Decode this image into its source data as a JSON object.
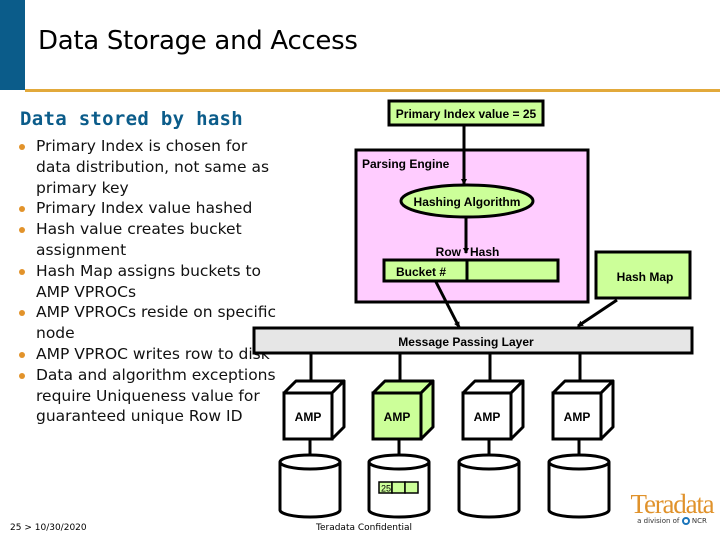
{
  "slide": {
    "title": "Data Storage and Access",
    "subtitle": "Data stored by hash",
    "bullets": [
      "Primary Index is chosen for data distribution, not same as primary key",
      "Primary Index value hashed",
      "Hash value creates bucket assignment",
      "Hash Map assigns buckets to AMP VPROCs",
      "AMP VPROCs reside on specific node",
      "AMP VPROC writes row to disk",
      "Data and algorithm exceptions require Uniqueness value for guaranteed unique Row ID"
    ],
    "colors": {
      "accent_blue": "#0b5c8a",
      "accent_orange": "#e2a93b",
      "box_green": "#ccff99",
      "parsing_engine_pink": "#ffccff",
      "mpl_gray": "#e6e6e6"
    }
  },
  "diagram": {
    "primary_index_label": "Primary Index value = 25",
    "parsing_engine_label": "Parsing Engine",
    "hashing_algorithm_label": "Hashing Algorithm",
    "row_label": "Row",
    "hash_label": "Hash",
    "bucket_label": "Bucket #",
    "hash_map_label": "Hash Map",
    "message_passing_layer_label": "Message Passing Layer",
    "amps": [
      {
        "label": "AMP",
        "highlighted": false
      },
      {
        "label": "AMP",
        "highlighted": true
      },
      {
        "label": "AMP",
        "highlighted": false
      },
      {
        "label": "AMP",
        "highlighted": false
      }
    ],
    "stored_row_value": "25"
  },
  "footer": {
    "page_number": "25",
    "separator": ">",
    "date": "10/30/2020",
    "confidential": "Teradata Confidential",
    "logo_text": "Teradata",
    "logo_subtext": "a division of",
    "logo_parent": "NCR"
  }
}
